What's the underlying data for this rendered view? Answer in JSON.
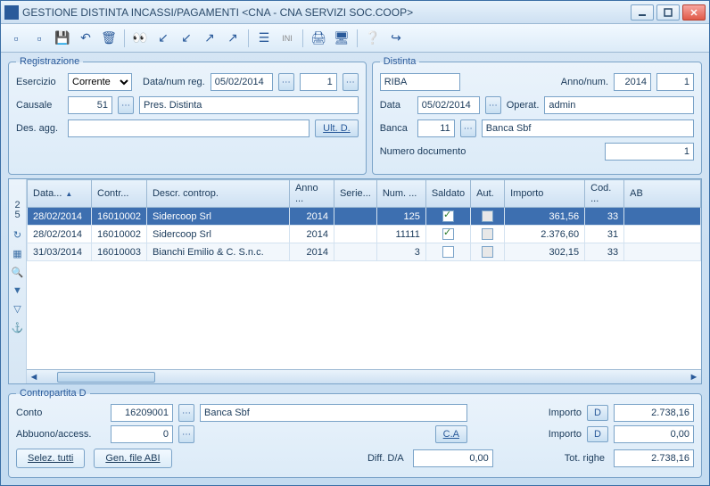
{
  "title": "GESTIONE DISTINTA INCASSI/PAGAMENTI <CNA - CNA SERVIZI SOC.COOP>",
  "registrazione": {
    "legend": "Registrazione",
    "esercizio_label": "Esercizio",
    "esercizio_value": "Corrente",
    "datanumreg_label": "Data/num reg.",
    "datanumreg_date": "05/02/2014",
    "datanumreg_num": "1",
    "causale_label": "Causale",
    "causale_code": "51",
    "causale_desc": "Pres. Distinta",
    "desagg_label": "Des. agg.",
    "desagg_value": "",
    "ultd_label": "Ult. D."
  },
  "distinta": {
    "legend": "Distinta",
    "tipo": "RIBA",
    "annonum_label": "Anno/num.",
    "anno": "2014",
    "num": "1",
    "data_label": "Data",
    "data_value": "05/02/2014",
    "operat_label": "Operat.",
    "operat_value": "admin",
    "banca_label": "Banca",
    "banca_code": "11",
    "banca_desc": "Banca Sbf",
    "numdoc_label": "Numero documento",
    "numdoc_value": "1"
  },
  "grid": {
    "row_count_top": "2",
    "row_count_bot": "5",
    "headers": {
      "data": "Data...",
      "contr": "Contr...",
      "descr": "Descr. controp.",
      "anno": "Anno ...",
      "serie": "Serie...",
      "num": "Num. ...",
      "saldato": "Saldato",
      "aut": "Aut.",
      "importo": "Importo",
      "cod": "Cod. ...",
      "ab": "AB"
    },
    "rows": [
      {
        "data": "28/02/2014",
        "contr": "16010002",
        "descr": "Sidercoop Srl",
        "anno": "2014",
        "serie": "",
        "num": "125",
        "saldato": true,
        "aut": false,
        "importo": "361,56",
        "cod": "33",
        "sel": true
      },
      {
        "data": "28/02/2014",
        "contr": "16010002",
        "descr": "Sidercoop Srl",
        "anno": "2014",
        "serie": "",
        "num": "11111",
        "saldato": true,
        "aut": false,
        "importo": "2.376,60",
        "cod": "31",
        "sel": false
      },
      {
        "data": "31/03/2014",
        "contr": "16010003",
        "descr": "Bianchi Emilio & C. S.n.c.",
        "anno": "2014",
        "serie": "",
        "num": "3",
        "saldato": false,
        "aut": false,
        "importo": "302,15",
        "cod": "33",
        "sel": false
      }
    ]
  },
  "contropartita": {
    "legend": "Contropartita D",
    "conto_label": "Conto",
    "conto_code": "16209001",
    "conto_desc": "Banca Sbf",
    "importo_label": "Importo",
    "importo1": "2.738,16",
    "abbuono_label": "Abbuono/access.",
    "abbuono_value": "0",
    "ca_label": "C.A",
    "importo2": "0,00",
    "d_badge": "D"
  },
  "footer": {
    "selez_tutti": "Selez. tutti",
    "gen_file": "Gen. file ABI",
    "diff_label": "Diff. D/A",
    "diff_value": "0,00",
    "tot_label": "Tot. righe",
    "tot_value": "2.738,16"
  }
}
